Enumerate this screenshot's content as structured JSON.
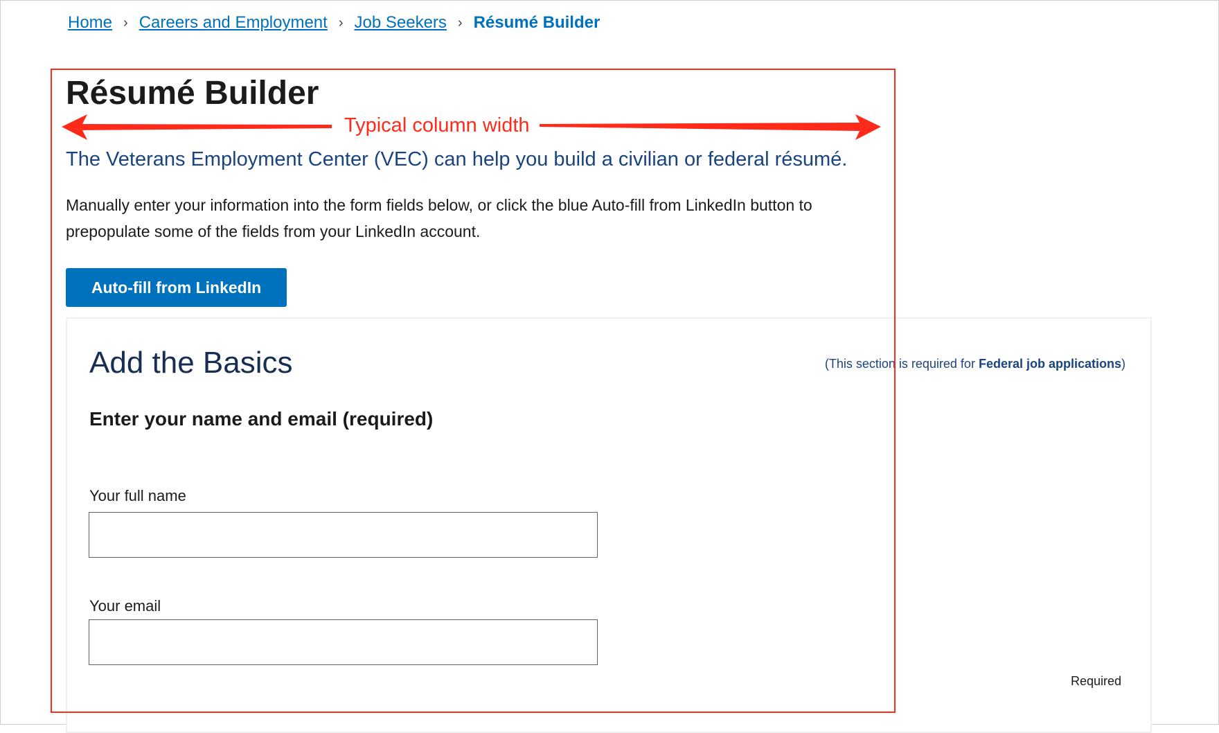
{
  "breadcrumb": {
    "items": [
      {
        "label": "Home"
      },
      {
        "label": "Careers and Employment"
      },
      {
        "label": "Job Seekers"
      }
    ],
    "current": "Résumé Builder",
    "separator": "›"
  },
  "page_title": "Résumé Builder",
  "annotation": {
    "label": "Typical column width",
    "color": "#ff2a1a"
  },
  "lead_text": "The Veterans Employment Center (VEC) can help you build a civilian or federal résumé.",
  "intro_text": "Manually enter your information into the form fields below, or click the blue Auto-fill from LinkedIn button to prepopulate some of the fields from your LinkedIn account.",
  "autofill_button": {
    "label": "Auto-fill from LinkedIn",
    "color": "#0071bc"
  },
  "basics": {
    "title": "Add the Basics",
    "note_prefix": "(This section is required for ",
    "note_bold": "Federal job applications",
    "note_suffix": ")",
    "subtitle": "Enter your name and email (required)",
    "fields": [
      {
        "label": "Your full name",
        "value": ""
      },
      {
        "label": "Your email",
        "value": ""
      }
    ],
    "required_label": "Required"
  }
}
